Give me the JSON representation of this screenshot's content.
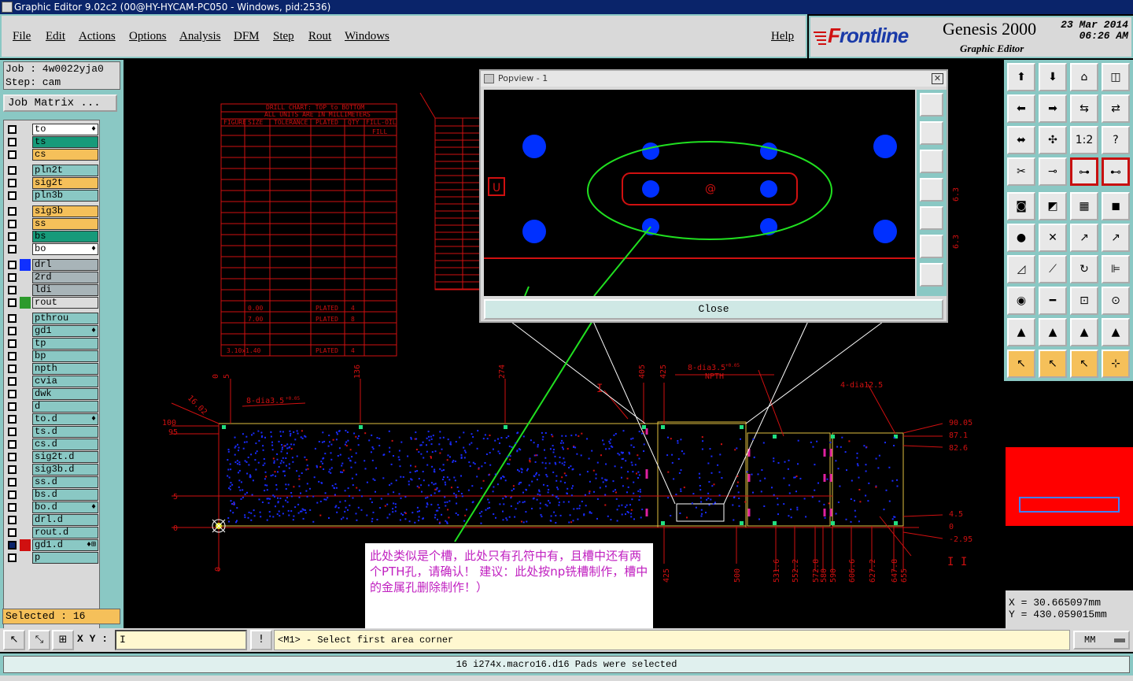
{
  "window": {
    "title": "Graphic Editor 9.02c2 (00@HY-HYCAM-PC050 - Windows, pid:2536)"
  },
  "menu": {
    "file": "File",
    "edit": "Edit",
    "actions": "Actions",
    "options": "Options",
    "analysis": "Analysis",
    "dfm": "DFM",
    "step": "Step",
    "rout": "Rout",
    "windows": "Windows",
    "help": "Help"
  },
  "brand": {
    "logo_a": "F",
    "logo_b": "rontline",
    "product": "Genesis 2000",
    "subtitle": "Graphic Editor",
    "date": "23 Mar 2014",
    "time": "06:26 AM"
  },
  "job": {
    "job_line": "Job : 4w0022yja0",
    "step_line": "Step: cam",
    "matrix_button": "Job Matrix ..."
  },
  "layers": [
    {
      "name": "to",
      "color": "#ffffff",
      "flag": "♦",
      "checked": false,
      "marker": ""
    },
    {
      "name": "ts",
      "color": "#179a7a",
      "flag": "",
      "checked": false,
      "marker": ""
    },
    {
      "name": "cs",
      "color": "#f5c05a",
      "flag": "",
      "checked": false,
      "marker": ""
    },
    {
      "name": "pln2t",
      "color": "#8ac8c4",
      "flag": "",
      "checked": false,
      "marker": ""
    },
    {
      "name": "sig2t",
      "color": "#f5c05a",
      "flag": "",
      "checked": false,
      "marker": ""
    },
    {
      "name": "pln3b",
      "color": "#8ac8c4",
      "flag": "",
      "checked": false,
      "marker": ""
    },
    {
      "name": "sig3b",
      "color": "#f5c05a",
      "flag": "",
      "checked": false,
      "marker": ""
    },
    {
      "name": "ss",
      "color": "#f5c05a",
      "flag": "",
      "checked": false,
      "marker": ""
    },
    {
      "name": "bs",
      "color": "#179a7a",
      "flag": "",
      "checked": false,
      "marker": ""
    },
    {
      "name": "bo",
      "color": "#ffffff",
      "flag": "♦",
      "checked": false,
      "marker": ""
    },
    {
      "name": "drl",
      "color": "#a8b4b8",
      "flag": "",
      "checked": false,
      "marker": "#1030ff"
    },
    {
      "name": "2rd",
      "color": "#a8b4b8",
      "flag": "",
      "checked": false,
      "marker": ""
    },
    {
      "name": "ldi",
      "color": "#a8b4b8",
      "flag": "",
      "checked": false,
      "marker": ""
    },
    {
      "name": "rout",
      "color": "#dcdcdc",
      "flag": "",
      "checked": false,
      "marker": "#2c9a2c"
    },
    {
      "name": "pthrou",
      "color": "#8ac8c4",
      "flag": "",
      "checked": false,
      "marker": ""
    },
    {
      "name": "gd1",
      "color": "#8ac8c4",
      "flag": "♦",
      "checked": false,
      "marker": ""
    },
    {
      "name": "tp",
      "color": "#8ac8c4",
      "flag": "",
      "checked": false,
      "marker": ""
    },
    {
      "name": "bp",
      "color": "#8ac8c4",
      "flag": "",
      "checked": false,
      "marker": ""
    },
    {
      "name": "npth",
      "color": "#8ac8c4",
      "flag": "",
      "checked": false,
      "marker": ""
    },
    {
      "name": "cvia",
      "color": "#8ac8c4",
      "flag": "",
      "checked": false,
      "marker": ""
    },
    {
      "name": "dwk",
      "color": "#8ac8c4",
      "flag": "",
      "checked": false,
      "marker": ""
    },
    {
      "name": "d",
      "color": "#8ac8c4",
      "flag": "",
      "checked": false,
      "marker": ""
    },
    {
      "name": "to.d",
      "color": "#8ac8c4",
      "flag": "♦",
      "checked": false,
      "marker": ""
    },
    {
      "name": "ts.d",
      "color": "#8ac8c4",
      "flag": "",
      "checked": false,
      "marker": ""
    },
    {
      "name": "cs.d",
      "color": "#8ac8c4",
      "flag": "",
      "checked": false,
      "marker": ""
    },
    {
      "name": "sig2t.d",
      "color": "#8ac8c4",
      "flag": "",
      "checked": false,
      "marker": ""
    },
    {
      "name": "sig3b.d",
      "color": "#8ac8c4",
      "flag": "",
      "checked": false,
      "marker": ""
    },
    {
      "name": "ss.d",
      "color": "#8ac8c4",
      "flag": "",
      "checked": false,
      "marker": ""
    },
    {
      "name": "bs.d",
      "color": "#8ac8c4",
      "flag": "",
      "checked": false,
      "marker": ""
    },
    {
      "name": "bo.d",
      "color": "#8ac8c4",
      "flag": "♦",
      "checked": false,
      "marker": ""
    },
    {
      "name": "drl.d",
      "color": "#8ac8c4",
      "flag": "",
      "checked": false,
      "marker": ""
    },
    {
      "name": "rout.d",
      "color": "#8ac8c4",
      "flag": "",
      "checked": false,
      "marker": ""
    },
    {
      "name": "gd1.d",
      "color": "#8ac8c4",
      "flag": "♦⊞",
      "checked": true,
      "marker": "#d01010"
    },
    {
      "name": "p",
      "color": "#8ac8c4",
      "flag": "",
      "checked": false,
      "marker": ""
    }
  ],
  "selected": "Selected : 16",
  "popview": {
    "title": "Popview - 1",
    "close_button": "Close",
    "close_x": "✕"
  },
  "note": {
    "text": "此处类似是个槽，此处只有孔符中有，且槽中还有两个PTH孔，请确认！  建议：此处按np铣槽制作，槽中的金属孔删除制作！）"
  },
  "coords": {
    "x": "X  = 30.665097mm",
    "y": "Y  = 430.059015mm"
  },
  "cmd": {
    "xy_label": "X Y :",
    "xy_value": "I",
    "message": "<M1> - Select first area corner",
    "unit": "MM",
    "alert": "!"
  },
  "status": {
    "text": "16 i274x.macro16.d16 Pads were selected"
  },
  "colors": {
    "accent": "#8ac8c4",
    "title": "#0a246a",
    "drawing": "#d01010",
    "pad": "#0030ff",
    "annotation": "#20e020"
  },
  "canvas": {
    "drill_chart_title": "DRILL CHART: TOP to BOTTOM",
    "drill_chart_sub": "ALL UNITS ARE IN MILLIMETERS",
    "drill_headers": [
      "FIGURE",
      "SIZE",
      "TOLERANCE",
      "PLATED",
      "QTY",
      "FILL-OIL"
    ],
    "drill_fill": "FILL",
    "drill_rows": [
      [
        "0.00",
        "PLATED",
        "4"
      ],
      [
        "7.00",
        "PLATED",
        "8"
      ],
      [
        "3.10x1.40",
        "PLATED",
        "4"
      ]
    ],
    "dims_top": [
      "0",
      "5",
      "136",
      "274",
      "405",
      "425"
    ],
    "dims_bottom": [
      "0",
      "425",
      "500",
      "531.6",
      "552.2",
      "572.8",
      "580",
      "590",
      "606.6",
      "627.2",
      "647.8",
      "655"
    ],
    "dims_right": [
      "90.05",
      "87.1",
      "82.6",
      "4.5",
      "0",
      "-2.95"
    ],
    "dims_left": [
      "100",
      "95",
      "5",
      "0"
    ],
    "labels": {
      "dia_a": "8-dia3.5",
      "dia_b": "8-dia3.5",
      "npth": "NPTH",
      "dia_c": "4-dia12.5",
      "tol": "+0.05",
      "i_mark": "I",
      "ii_mark": "I I",
      "r_label": "16.02",
      "pop_u": "U",
      "pop_at": "@",
      "dim_63": "6.3"
    }
  }
}
